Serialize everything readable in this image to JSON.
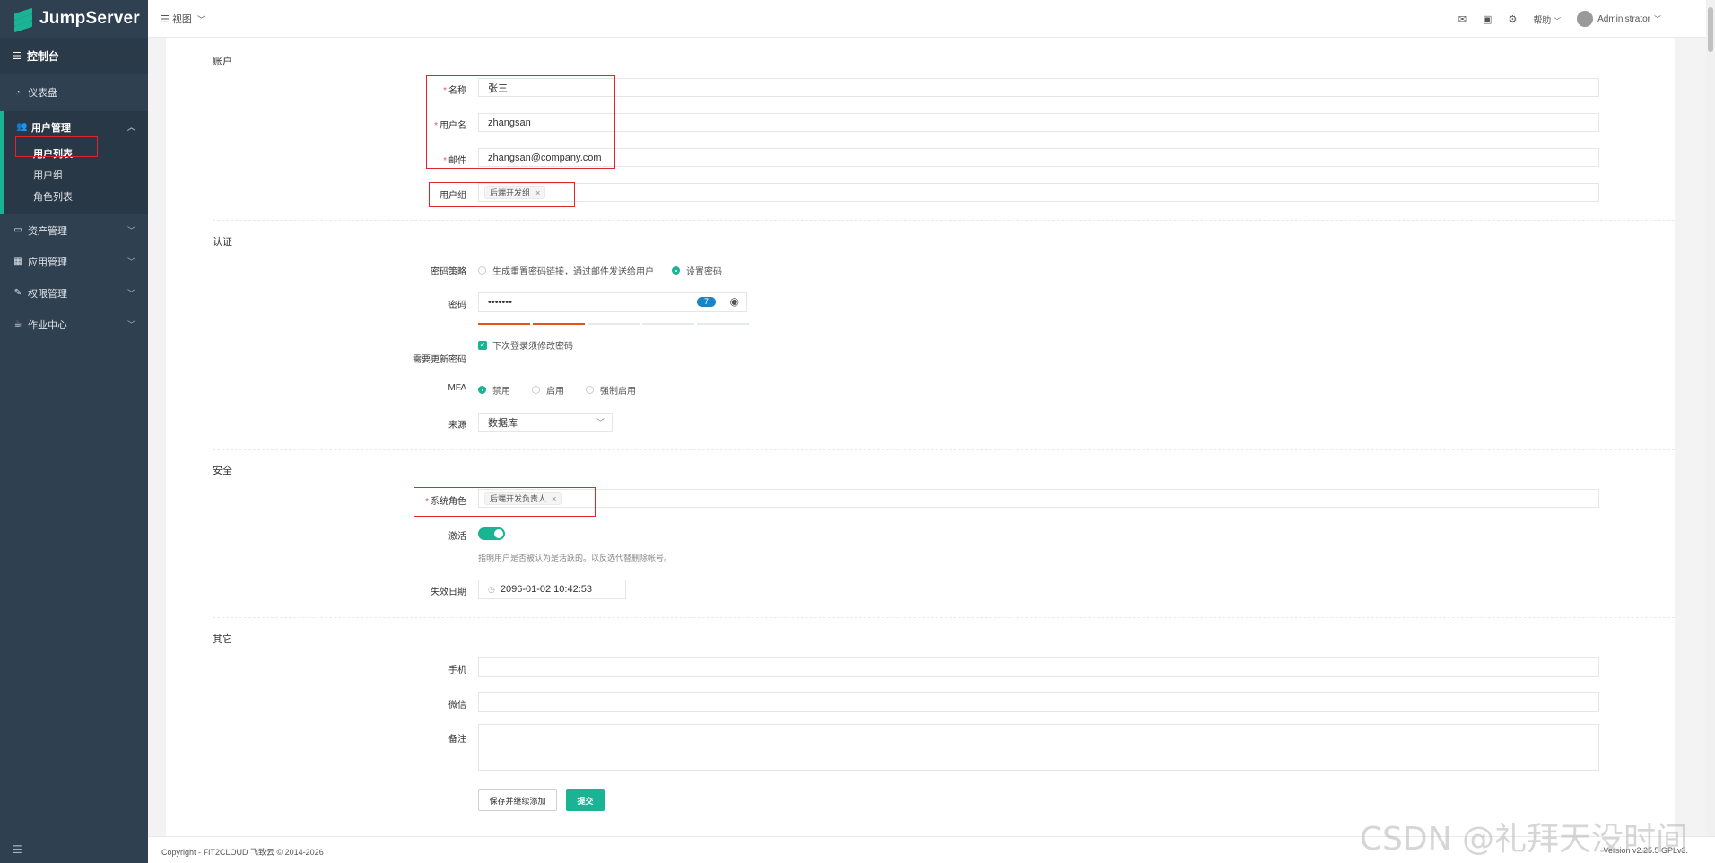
{
  "brand": {
    "name": "JumpServer"
  },
  "sidebar": {
    "console": "控制台",
    "items": [
      {
        "icon": "dashboard-icon",
        "label": "仪表盘"
      },
      {
        "icon": "users-icon",
        "label": "用户管理"
      },
      {
        "icon": "asset-icon",
        "label": "资产管理"
      },
      {
        "icon": "apps-icon",
        "label": "应用管理"
      },
      {
        "icon": "permission-icon",
        "label": "权限管理"
      },
      {
        "icon": "job-icon",
        "label": "作业中心"
      }
    ],
    "user_sub": [
      "用户列表",
      "用户组",
      "角色列表"
    ]
  },
  "topbar": {
    "view": "视图",
    "help": "帮助",
    "user": "Administrator"
  },
  "sections": {
    "account": "账户",
    "auth": "认证",
    "security": "安全",
    "other": "其它"
  },
  "form": {
    "name_label": "名称",
    "name_value": "张三",
    "username_label": "用户名",
    "username_value": "zhangsan",
    "email_label": "邮件",
    "email_value": "zhangsan@company.com",
    "group_label": "用户组",
    "group_tag": "后端开发组",
    "pwd_strategy_label": "密码策略",
    "pwd_strategy_opt1": "生成重置密码链接，通过邮件发送给用户",
    "pwd_strategy_opt2": "设置密码",
    "password_label": "密码",
    "password_value": "•••••••",
    "password_badge": "7",
    "need_update_label": "需要更新密码",
    "need_update_opt": "下次登录须修改密码",
    "mfa_label": "MFA",
    "mfa_opts": [
      "禁用",
      "启用",
      "强制启用"
    ],
    "source_label": "来源",
    "source_value": "数据库",
    "role_label": "系统角色",
    "role_tag": "后端开发负责人",
    "active_label": "激活",
    "active_hint": "指明用户是否被认为是活跃的。以反选代替删除帐号。",
    "expire_label": "失效日期",
    "expire_value": "2096-01-02 10:42:53",
    "phone_label": "手机",
    "wechat_label": "微信",
    "comment_label": "备注",
    "save_continue": "保存并继续添加",
    "submit": "提交"
  },
  "footer": {
    "copyright": "Copyright - FIT2CLOUD 飞致云 © 2014-2026",
    "version": "Version v2.25.5 GPLv3."
  },
  "watermark": "CSDN @礼拜天没时间"
}
